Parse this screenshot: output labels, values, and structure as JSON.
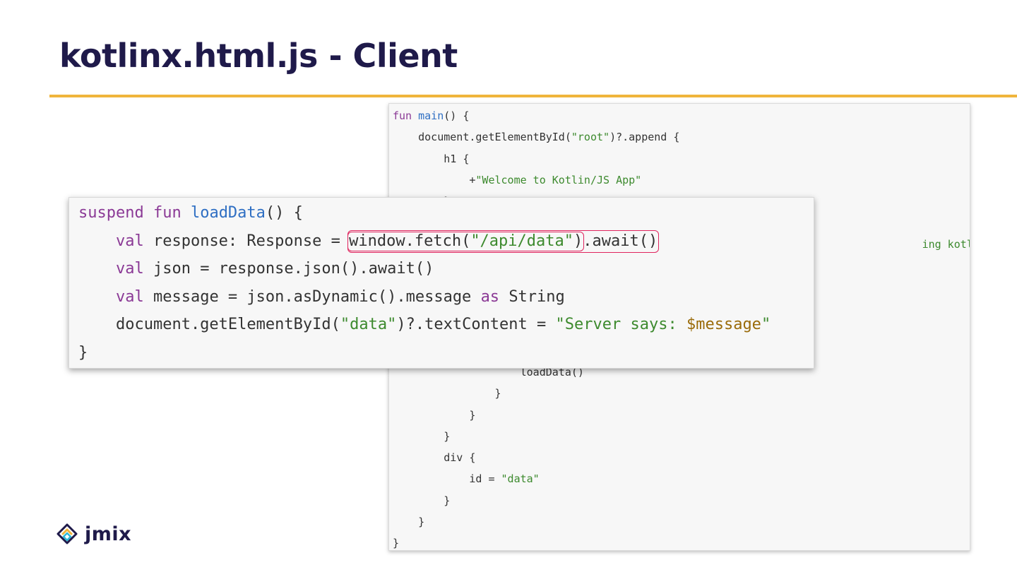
{
  "slide": {
    "title": "kotlinx.html.js - Client"
  },
  "back_code": {
    "lines": [
      [
        {
          "t": "fun ",
          "c": "kw"
        },
        {
          "t": "main",
          "c": "fn"
        },
        {
          "t": "() {",
          "c": ""
        }
      ],
      [
        {
          "t": "    document.getElementById(",
          "c": ""
        },
        {
          "t": "\"root\"",
          "c": "st"
        },
        {
          "t": ")?.append {",
          "c": ""
        }
      ],
      [
        {
          "t": "        h1 {",
          "c": ""
        }
      ],
      [
        {
          "t": "            +",
          "c": ""
        },
        {
          "t": "\"Welcome to Kotlin/JS App\"",
          "c": "st"
        }
      ],
      [
        {
          "t": "        }",
          "c": ""
        }
      ],
      [
        {
          "t": "",
          "c": ""
        }
      ],
      [
        {
          "t": "                                                                                   ",
          "c": ""
        },
        {
          "t": "ing kotlinx.html.js.\"",
          "c": "st"
        }
      ],
      [
        {
          "t": "",
          "c": ""
        }
      ],
      [
        {
          "t": "",
          "c": ""
        }
      ],
      [
        {
          "t": "",
          "c": ""
        }
      ],
      [
        {
          "t": "",
          "c": ""
        }
      ],
      [
        {
          "t": "",
          "c": ""
        }
      ],
      [
        {
          "t": "                    loadData()",
          "c": ""
        }
      ],
      [
        {
          "t": "                }",
          "c": ""
        }
      ],
      [
        {
          "t": "            }",
          "c": ""
        }
      ],
      [
        {
          "t": "        }",
          "c": ""
        }
      ],
      [
        {
          "t": "        div {",
          "c": ""
        }
      ],
      [
        {
          "t": "            id = ",
          "c": ""
        },
        {
          "t": "\"data\"",
          "c": "st"
        }
      ],
      [
        {
          "t": "        }",
          "c": ""
        }
      ],
      [
        {
          "t": "    }",
          "c": ""
        }
      ],
      [
        {
          "t": "}",
          "c": ""
        }
      ]
    ]
  },
  "front_code": {
    "line1": [
      {
        "t": "suspend ",
        "c": "kw"
      },
      {
        "t": "fun ",
        "c": "kw"
      },
      {
        "t": "loadData",
        "c": "fn"
      },
      {
        "t": "() {",
        "c": ""
      }
    ],
    "line2_prefix": [
      {
        "t": "    ",
        "c": ""
      },
      {
        "t": "val ",
        "c": "kw"
      },
      {
        "t": "response: Response = ",
        "c": ""
      }
    ],
    "line2_highlight": "window.fetch(\"/api/data\")",
    "line2_highlight_string": "\"/api/data\"",
    "line2_suffix": ".await()",
    "line3": [
      {
        "t": "    ",
        "c": ""
      },
      {
        "t": "val ",
        "c": "kw"
      },
      {
        "t": "json = response.json().await()",
        "c": ""
      }
    ],
    "line4": [
      {
        "t": "    ",
        "c": ""
      },
      {
        "t": "val ",
        "c": "kw"
      },
      {
        "t": "message = json.asDynamic().message ",
        "c": ""
      },
      {
        "t": "as ",
        "c": "kw"
      },
      {
        "t": "String",
        "c": ""
      }
    ],
    "line5": [
      {
        "t": "    document.getElementById(",
        "c": ""
      },
      {
        "t": "\"data\"",
        "c": "st"
      },
      {
        "t": ")?.textContent = ",
        "c": ""
      },
      {
        "t": "\"Server says: ",
        "c": "st"
      },
      {
        "t": "$message",
        "c": "tp"
      },
      {
        "t": "\"",
        "c": "st"
      }
    ],
    "line6": [
      {
        "t": "}",
        "c": ""
      }
    ]
  },
  "brand": {
    "logo_text": "jmix",
    "icon": "jmix-logo-icon",
    "accent_color": "#f0b53c",
    "title_color": "#1f1a4a",
    "highlight_color": "#e0245e"
  }
}
